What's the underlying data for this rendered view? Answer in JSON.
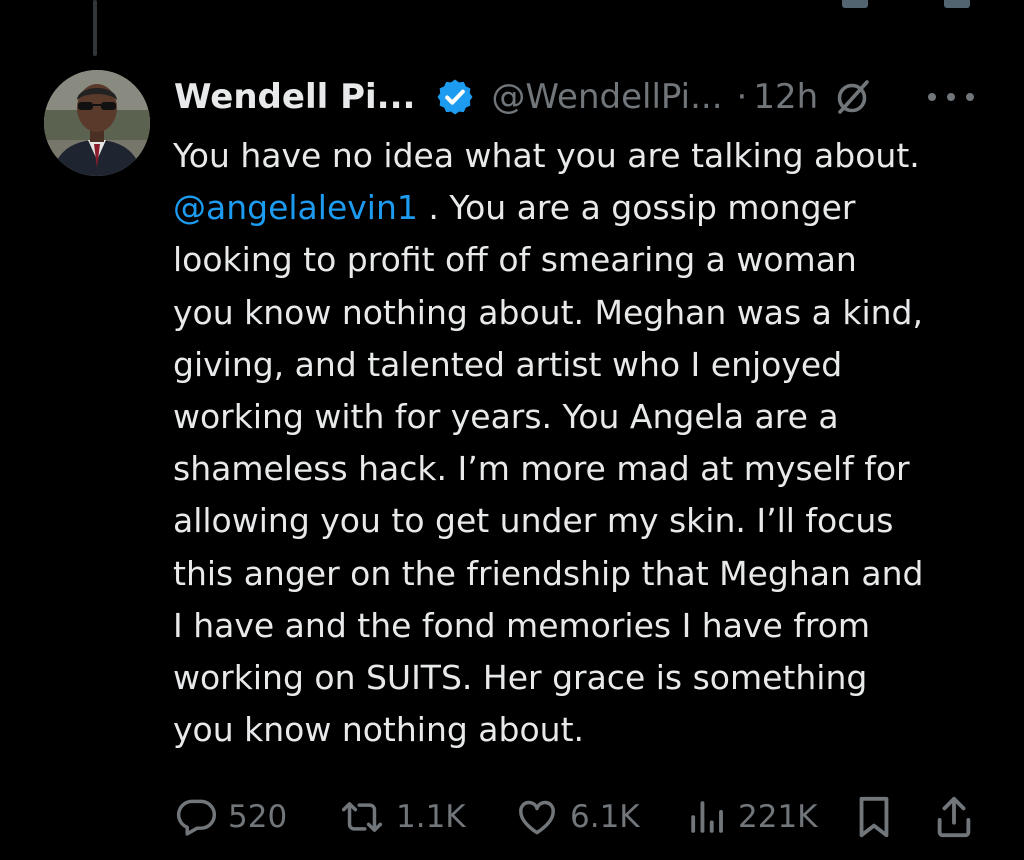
{
  "tweet": {
    "author_name": "Wendell Pi...",
    "author_handle": "@WendellPi...",
    "separator": "·",
    "timestamp": "12h",
    "body_lines": [
      "You have no idea what you are talking about.",
      ". You are a gossip monger",
      "looking to profit off of smearing a woman",
      "you know nothing about. Meghan was a kind,",
      "giving, and talented artist who I enjoyed",
      "working with for years. You Angela are a",
      "shameless hack. I’m more mad at myself for",
      "allowing you to get under my skin. I’ll focus",
      "this anger on the friendship that Meghan and",
      "I have and the fond memories I have from",
      "working on SUITS. Her grace is something",
      "you know nothing about."
    ],
    "mention": "@angelalevin1"
  },
  "actions": {
    "replies": "520",
    "reposts": "1.1K",
    "likes": "6.1K",
    "views": "221K"
  },
  "icons": {
    "verified": "verified-badge-icon",
    "grok": "grok-icon",
    "more": "more-icon",
    "reply": "reply-icon",
    "repost": "repost-icon",
    "like": "heart-icon",
    "views": "views-chart-icon",
    "bookmark": "bookmark-icon",
    "share": "share-icon"
  },
  "colors": {
    "background": "#000000",
    "text": "#e7e9ea",
    "muted": "#71767b",
    "accent": "#1d9bf0"
  }
}
